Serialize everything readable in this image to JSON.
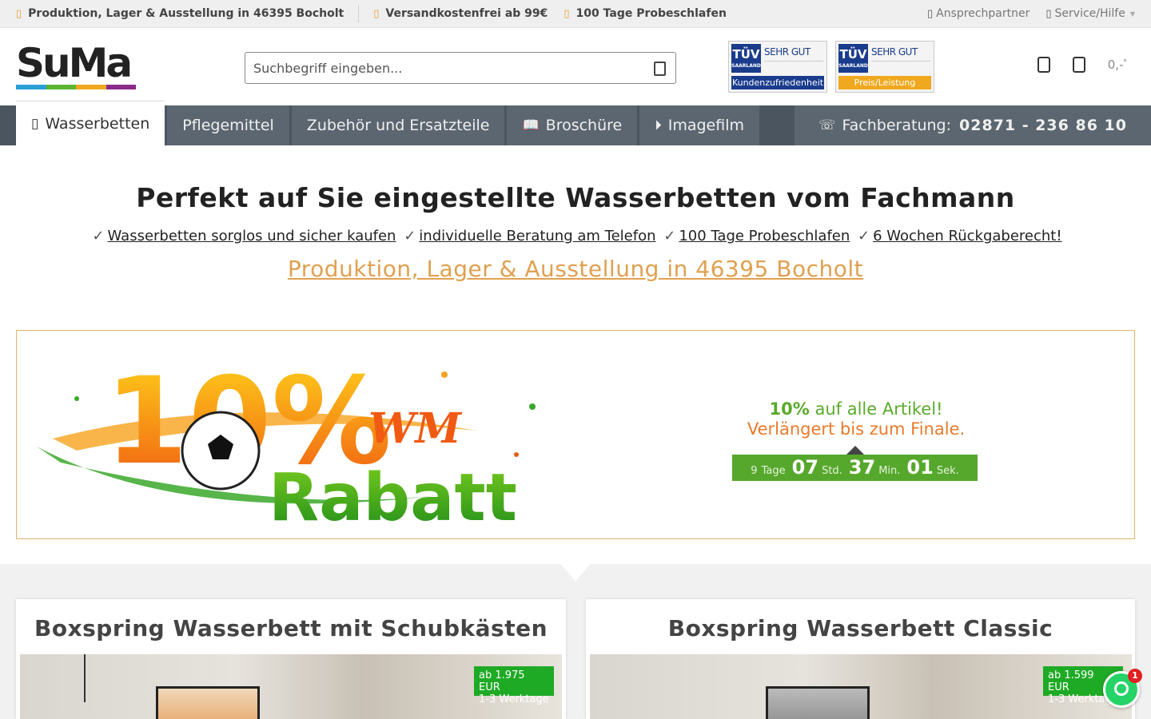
{
  "topbar": {
    "usp1": "Produktion, Lager & Ausstellung in 46395 Bocholt",
    "usp2": "Versandkostenfrei ab 99€",
    "usp3": "100 Tage Probeschlafen",
    "contact": "Ansprechpartner",
    "service": "Service/Hilfe"
  },
  "header": {
    "logo_text": "SuMa",
    "logo_colors": [
      "#2a9fd6",
      "#5cb531",
      "#f0a81e",
      "#8a2a8a"
    ],
    "search_placeholder": "Suchbegriff eingeben...",
    "badges": [
      {
        "tuv": "TÜV",
        "region": "SAARLAND",
        "rating": "SEHR GUT",
        "label": "Kundenzufriedenheit",
        "color": "#1a3c8c"
      },
      {
        "tuv": "TÜV",
        "region": "SAARLAND",
        "rating": "SEHR GUT",
        "label": "Preis/Leistung",
        "color": "#f0a81e"
      }
    ],
    "cart_value": "0,-",
    "cart_suffix": "*"
  },
  "nav": {
    "items": [
      {
        "label": "Wasserbetten",
        "icon": "bed-icon",
        "active": true
      },
      {
        "label": "Pflegemittel"
      },
      {
        "label": "Zubehör und Ersatzteile"
      },
      {
        "label": "Broschüre",
        "icon": "book-icon"
      },
      {
        "label": "Imagefilm",
        "icon": "play-icon"
      }
    ],
    "phone_label": "Fachberatung:",
    "phone_number": "02871 - 236 86 10"
  },
  "hero": {
    "title": "Perfekt auf Sie eingestellte Wasserbetten vom Fachmann",
    "usps": [
      "Wasserbetten sorglos und sicher kaufen",
      "individuelle Beratung am Telefon",
      "100 Tage Probeschlafen",
      "6 Wochen Rückgaberecht!"
    ],
    "check": "✓",
    "location": "Produktion, Lager & Ausstellung in 46395 Bocholt"
  },
  "promo": {
    "big_number": "10%",
    "tag": "WM",
    "word": "Rabatt",
    "line1_bold": "10%",
    "line1_rest": "auf alle Artikel!",
    "line2": "Verlängert bis zum Finale.",
    "timer": {
      "days": "9",
      "days_unit": "Tage",
      "hours": "07",
      "hours_unit": "Std.",
      "minutes": "37",
      "minutes_unit": "Min.",
      "seconds": "01",
      "seconds_unit": "Sek."
    }
  },
  "products": [
    {
      "title": "Boxspring Wasserbett mit Schubkästen",
      "price": "ab 1.975 EUR",
      "delivery": "1-3 Werktage"
    },
    {
      "title": "Boxspring Wasserbett Classic",
      "price": "ab 1.599 EUR",
      "delivery": "1-3 Werktage"
    }
  ],
  "whatsapp": {
    "count": "1"
  }
}
